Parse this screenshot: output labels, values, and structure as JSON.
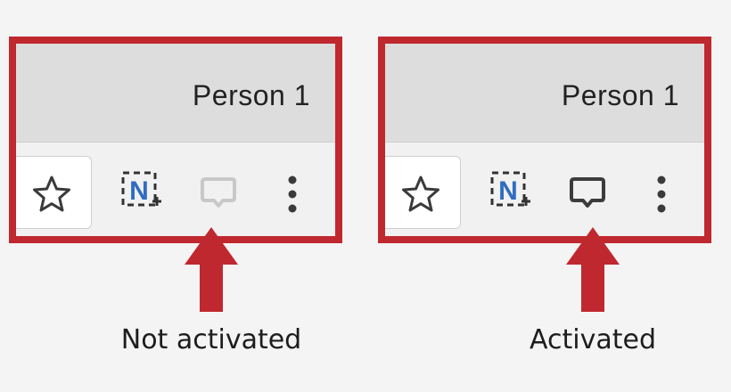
{
  "colors": {
    "frame": "#c0282f",
    "arrow": "#c0282f",
    "titlebar": "#dddddd",
    "toolbar": "#f1f1f1",
    "extension_blue": "#2f6dc0",
    "chat_inactive": "#c8c8c8",
    "chat_active": "#3c3c3c"
  },
  "panels": [
    {
      "profile_name": "Person 1",
      "icons": [
        "star-icon",
        "extension-n-plus-icon",
        "chat-bubble-icon",
        "kebab-menu-icon"
      ],
      "chat_state": "inactive",
      "caption": "Not activated"
    },
    {
      "profile_name": "Person 1",
      "icons": [
        "star-icon",
        "extension-n-plus-icon",
        "chat-bubble-icon",
        "kebab-menu-icon"
      ],
      "chat_state": "active",
      "caption": "Activated"
    }
  ]
}
